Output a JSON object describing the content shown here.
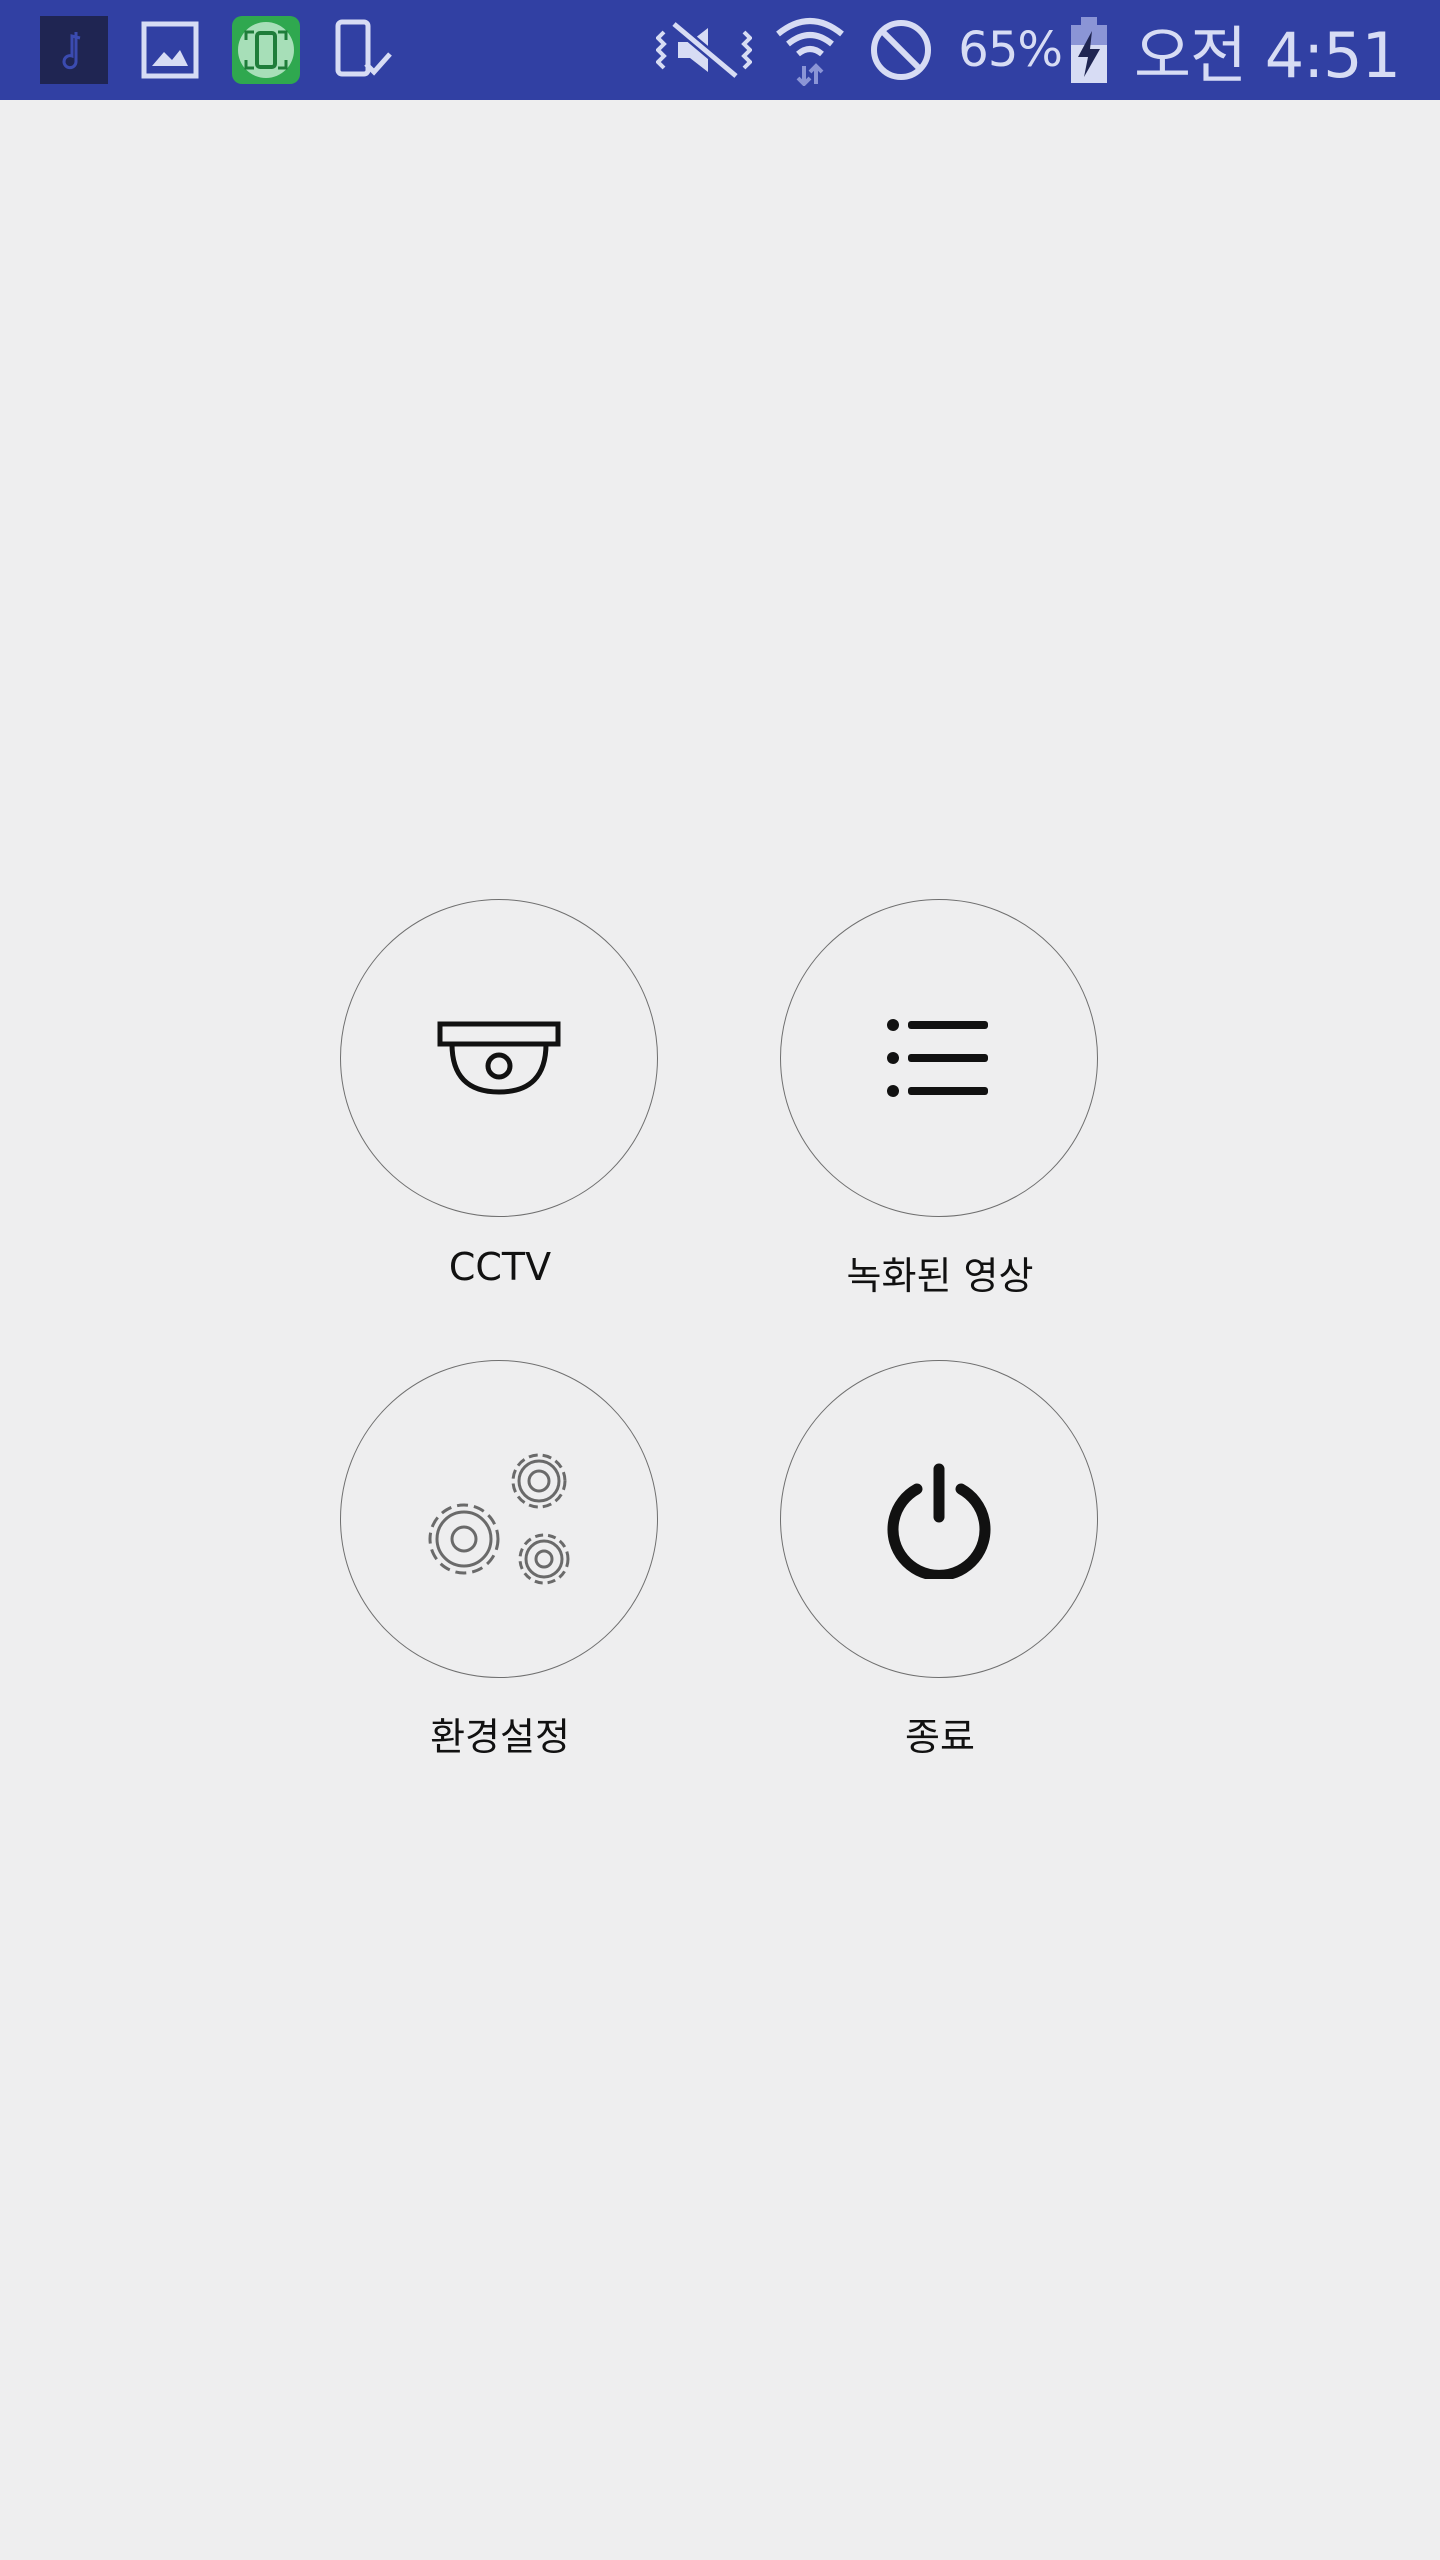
{
  "status_bar": {
    "background_color": "#3140a3",
    "left_icons": [
      "music-note-icon",
      "gallery-icon",
      "screen-mirror-icon",
      "phone-check-icon"
    ],
    "right_icons": [
      "mute-vibrate-icon",
      "wifi-icon",
      "block-icon",
      "battery-charging-icon"
    ],
    "battery": "65%",
    "time": "오전 4:51"
  },
  "menu": {
    "items": [
      {
        "label": "CCTV",
        "icon": "cctv-camera-icon"
      },
      {
        "label": "녹화된 영상",
        "icon": "list-icon"
      },
      {
        "label": "환경설정",
        "icon": "gears-icon"
      },
      {
        "label": "종료",
        "icon": "power-icon"
      }
    ]
  }
}
